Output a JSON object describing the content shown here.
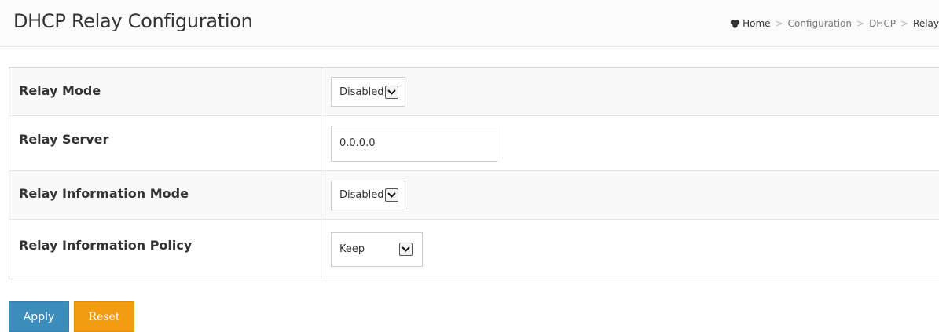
{
  "header": {
    "title": "DHCP Relay Configuration",
    "breadcrumb": {
      "home": "Home",
      "items": [
        "Configuration",
        "DHCP"
      ],
      "current": "Relay",
      "separator": ">"
    }
  },
  "form": {
    "rows": [
      {
        "label": "Relay Mode",
        "control": "select",
        "value": "Disabled"
      },
      {
        "label": "Relay Server",
        "control": "input",
        "value": "0.0.0.0"
      },
      {
        "label": "Relay Information Mode",
        "control": "select",
        "value": "Disabled"
      },
      {
        "label": "Relay Information Policy",
        "control": "select",
        "value": "Keep"
      }
    ]
  },
  "actions": {
    "apply_label": "Apply",
    "reset_label": "Reset"
  },
  "colors": {
    "apply": "#3c8dbc",
    "reset": "#f39c12"
  },
  "icons": {
    "home": "home-icon",
    "dropdown": "chevron-down-icon"
  }
}
